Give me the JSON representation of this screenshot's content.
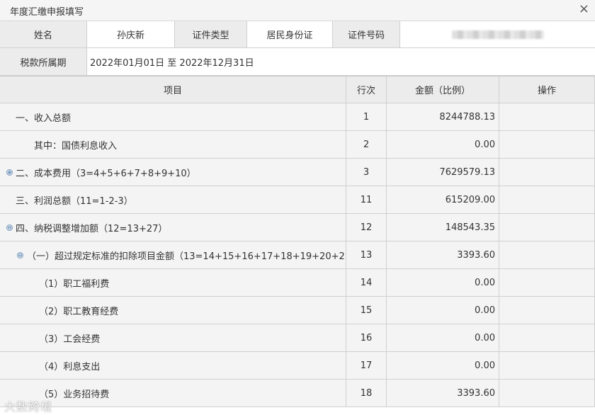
{
  "window": {
    "title": "年度汇缴申报填写",
    "close_label": "×"
  },
  "info": {
    "name_label": "姓名",
    "name_value": "孙庆新",
    "id_type_label": "证件类型",
    "id_type_value": "居民身份证",
    "id_no_label": "证件号码",
    "period_label": "税款所属期",
    "period_value": "2022年01月01日 至 2022年12月31日"
  },
  "table": {
    "headers": {
      "item": "项目",
      "row_no": "行次",
      "amount": "金额（比例）",
      "action": "操作"
    },
    "rows": [
      {
        "item": "一、收入总额",
        "row_no": "1",
        "amount": "8244788.13"
      },
      {
        "item": "其中：国债利息收入",
        "row_no": "2",
        "amount": "0.00"
      },
      {
        "item": "二、成本费用（3=4+5+6+7+8+9+10）",
        "row_no": "3",
        "amount": "7629579.13",
        "toggle": "⊕"
      },
      {
        "item": "三、利润总额（11=1-2-3）",
        "row_no": "11",
        "amount": "615209.00"
      },
      {
        "item": "四、纳税调整增加额（12=13+27）",
        "row_no": "12",
        "amount": "148543.35",
        "toggle": "⊖"
      },
      {
        "item": "（一）超过规定标准的扣除项目金额（13=14+15+16+17+18+19+20+21+2",
        "row_no": "13",
        "amount": "3393.60",
        "toggle": "⊖"
      },
      {
        "item": "（1）职工福利费",
        "row_no": "14",
        "amount": "0.00"
      },
      {
        "item": "（2）职工教育经费",
        "row_no": "15",
        "amount": "0.00"
      },
      {
        "item": "（3）工会经费",
        "row_no": "16",
        "amount": "0.00"
      },
      {
        "item": "（4）利息支出",
        "row_no": "17",
        "amount": "0.00"
      },
      {
        "item": "（5）业务招待费",
        "row_no": "18",
        "amount": "3393.60"
      }
    ]
  },
  "watermark": "大数跨境"
}
